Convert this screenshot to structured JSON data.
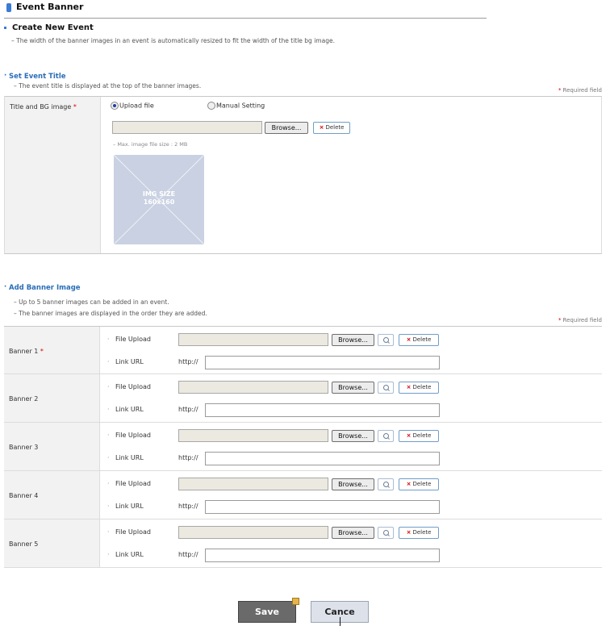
{
  "header": {
    "title": "Event Banner"
  },
  "create": {
    "title": "Create New Event",
    "note": "– The width of the banner images in an event is automatically resized to fit the width of the title bg image."
  },
  "event_title": {
    "heading": "Set Event Title",
    "note": "– The event title is displayed at the top of the banner images.",
    "required_label": "Required field",
    "field_label": "Title and BG image",
    "radio_upload": "Upload file",
    "radio_manual": "Manual Setting",
    "browse_label": "Browse...",
    "delete_label": "Delete",
    "size_hint": "– Max. image file size : 2 MB",
    "placeholder_caption": "IMG SIZE\n160x160"
  },
  "banner_section": {
    "heading": "Add Banner Image",
    "note1": "– Up to 5 banner images can be added in an event.",
    "note2": "– The banner images are displayed in the order they are added.",
    "required_label": "Required field",
    "file_upload_label": "File Upload",
    "link_url_label": "Link URL",
    "http_prefix": "http://",
    "browse_label": "Browse...",
    "delete_label": "Delete",
    "banners": [
      {
        "label": "Banner 1",
        "required": true
      },
      {
        "label": "Banner 2",
        "required": false
      },
      {
        "label": "Banner 3",
        "required": false
      },
      {
        "label": "Banner 4",
        "required": false
      },
      {
        "label": "Banner 5",
        "required": false
      }
    ]
  },
  "actions": {
    "save": "Save",
    "cancel": "Cance"
  }
}
